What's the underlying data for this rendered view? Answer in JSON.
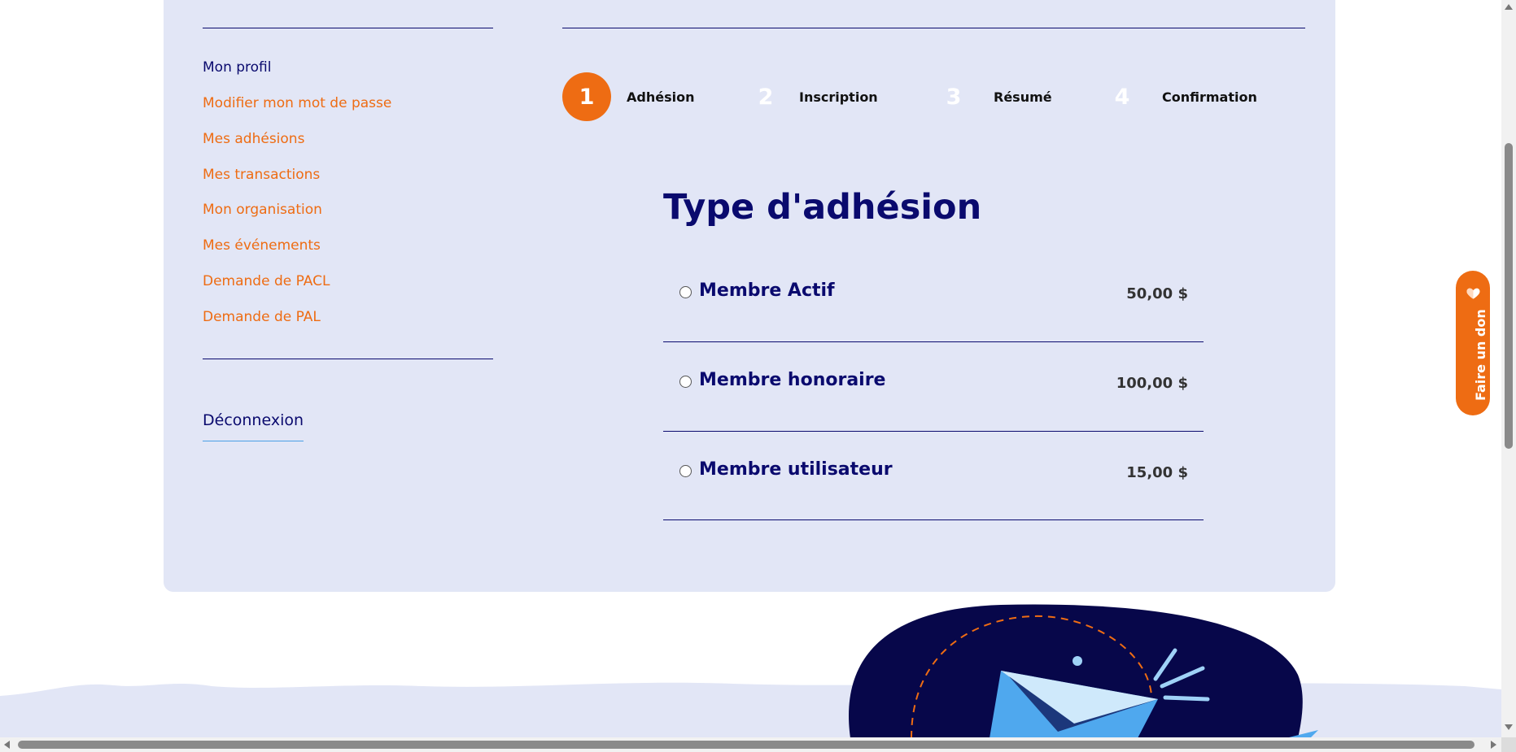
{
  "sidebar": {
    "items": [
      {
        "label": "Mon profil",
        "active": true
      },
      {
        "label": "Modifier mon mot de passe",
        "active": false
      },
      {
        "label": "Mes adhésions",
        "active": false
      },
      {
        "label": "Mes transactions",
        "active": false
      },
      {
        "label": "Mon organisation",
        "active": false
      },
      {
        "label": "Mes événements",
        "active": false
      },
      {
        "label": "Demande de PACL",
        "active": false
      },
      {
        "label": "Demande de PAL",
        "active": false
      }
    ],
    "logout_label": "Déconnexion"
  },
  "steps": [
    {
      "number": "1",
      "label": "Adhésion",
      "active": true
    },
    {
      "number": "2",
      "label": "Inscription",
      "active": false
    },
    {
      "number": "3",
      "label": "Résumé",
      "active": false
    },
    {
      "number": "4",
      "label": "Confirmation",
      "active": false
    }
  ],
  "membership": {
    "title": "Type d'adhésion",
    "options": [
      {
        "name": "Membre Actif",
        "price": "50,00 $",
        "selected": false
      },
      {
        "name": "Membre honoraire",
        "price": "100,00 $",
        "selected": false
      },
      {
        "name": "Membre utilisateur",
        "price": "15,00 $",
        "selected": false
      }
    ]
  },
  "donate": {
    "label": "Faire un don",
    "icon": "heart-icon"
  },
  "colors": {
    "accent": "#ee6c13",
    "navy": "#0a0a6e",
    "panel": "#e2e6f6",
    "sky": "#4fa8ee"
  }
}
